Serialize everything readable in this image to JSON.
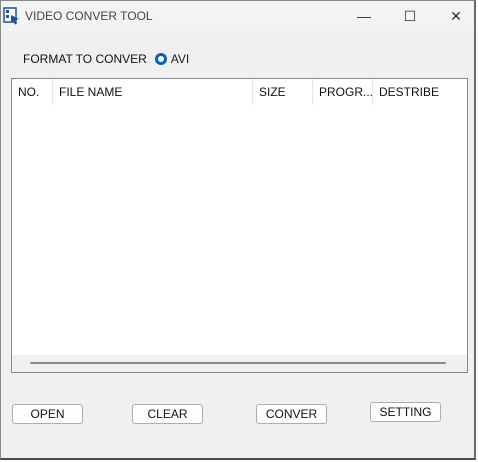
{
  "window": {
    "title": "VIDEO CONVER TOOL",
    "controls": {
      "minimize": "—",
      "maximize": "☐",
      "close": "✕"
    }
  },
  "format": {
    "label": "FORMAT TO CONVER",
    "option_label": "AVI",
    "selected": true
  },
  "list": {
    "columns": [
      "NO.",
      "FILE NAME",
      "SIZE",
      "PROGR...",
      "DESTRIBE"
    ],
    "rows": []
  },
  "buttons": {
    "open": "OPEN",
    "clear": "CLEAR",
    "conver": "CONVER",
    "setting": "SETTING"
  },
  "colors": {
    "accent": "#0a5fb4",
    "window_bg": "#f0f0f0",
    "list_bg": "#ffffff"
  }
}
